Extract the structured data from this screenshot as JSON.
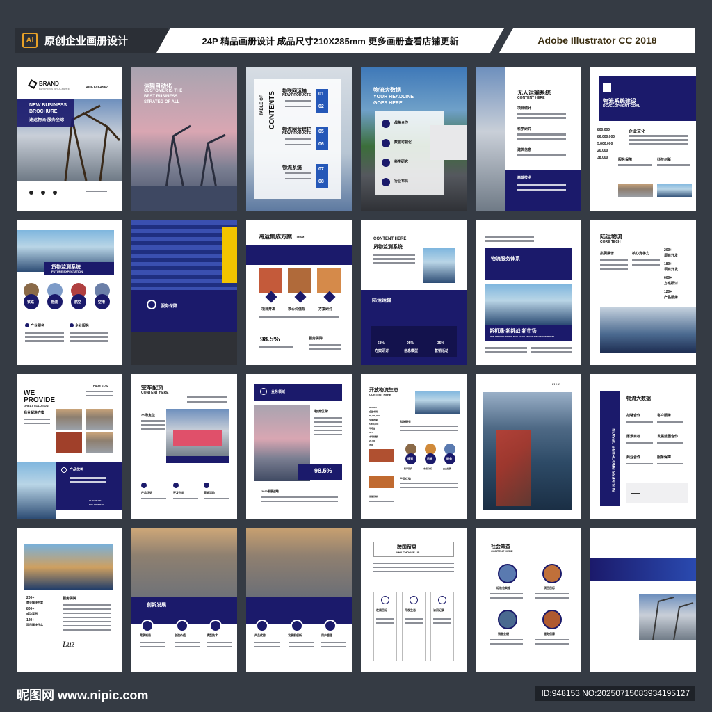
{
  "header": {
    "ai_badge": "Ai",
    "left_title": "原创企业画册设计",
    "center_title": "24P 精品画册设计 成品尺寸210X285mm 更多画册查看店铺更新",
    "right_title": "Adobe Illustrator CC 2018"
  },
  "pages": {
    "p1": {
      "brand": "BRAND",
      "brand_sub": "BUSINESS BROCHURE",
      "title1": "NEW BUSINESS",
      "title2": "BROCHURE",
      "cn": "速运物流·服务全球",
      "phone": "400-123-4567"
    },
    "p2": {
      "cn": "运输自动化",
      "en1": "CUSTOMER IS THE",
      "en2": "BEST BUSINESS",
      "en3": "STRATEG OF ALL"
    },
    "p3": {
      "toc_a": "TABLE OF",
      "toc_b": "CONTENTS",
      "s1": "物联网运输",
      "s1e": "NEW PRODUCTS",
      "s2": "物流网营建护",
      "s2e": "NEW PRODUCTS",
      "s3": "物流系统",
      "n1": "01",
      "n2": "02",
      "n3": "05",
      "n4": "06",
      "n5": "07",
      "n6": "08"
    },
    "p4": {
      "cn": "物流大数据",
      "en1": "YOUR HEADLINE",
      "en2": "GOES HERE",
      "i1": "战略合作",
      "i2": "数据可视化",
      "i3": "科学研究",
      "i4": "行业布局"
    },
    "p5": {
      "cn": "无人运输系统",
      "en": "CONTENT HERE",
      "a": "项目统计",
      "b": "科学研究",
      "c": "建筑信息",
      "d": "高端技术"
    },
    "p6": {
      "cn": "物流系统建设",
      "en": "DEVELOPMENT GOAL",
      "a": "企业文化",
      "b": "服务保障",
      "c": "科技创新",
      "n1": "800,000",
      "n2": "86,000,000",
      "n3": "5,800,000",
      "n4": "20,000",
      "n5": "38,000"
    },
    "p7": {
      "cn": "货物监测系统",
      "en": "FUTURE EXPECTATION",
      "c1": "铁路",
      "c2": "物流",
      "c3": "航空",
      "c4": "空港",
      "b1": "产业服务",
      "b2": "企业服务"
    },
    "p8": {
      "cn": "服务保障"
    },
    "p9": {
      "cn": "海运集成方案",
      "en": "TEAM",
      "a": "项目开发",
      "b": "核心价值观",
      "c": "方案研讨",
      "pct": "98.5%",
      "d": "服务保障"
    },
    "p10": {
      "en": "CONTENT HERE",
      "cn": "货物监测系统",
      "band": "陆运运输",
      "s1": "68%",
      "s1l": "方案研讨",
      "s2": "95%",
      "s2l": "信息模型",
      "s3": "35%",
      "s3l": "营销活动"
    },
    "p11": {
      "cn": "物流服务体系",
      "band": "新机遇·新挑战·新市场",
      "band_en": "NEW OPPORTUNITIES, NEW CHALLENGES AND NEW MARKETS"
    },
    "p12": {
      "cn": "陆运物流",
      "en": "CORE TECH",
      "a": "案例展示",
      "b": "核心竞争力",
      "n1": "200+",
      "l1": "项目开发",
      "n2": "180+",
      "l2": "项目开发",
      "n3": "600+",
      "l3": "方案研讨",
      "n4": "120+",
      "l4": "产品服务"
    },
    "p13": {
      "en1": "WE",
      "en2": "PROVIDE",
      "en3": "GREAT SOLUTION",
      "page": "PAGE 01/02",
      "a": "商业解决方案",
      "b": "产品优势",
      "c": "OUR VALUE",
      "d": "THE COMPANY"
    },
    "p14": {
      "cn": "空车配货",
      "en": "CONTENT HERE",
      "a": "市场定位",
      "b": "产品优势",
      "c": "开发生态",
      "d": "营销活动"
    },
    "p15": {
      "cn": "业务领域",
      "a": "物流优势",
      "pct": "98.5%",
      "b": "2030发展战略"
    },
    "p16": {
      "cn": "开放物流生态",
      "en": "CONTENT HERE",
      "n1": "800,000",
      "l1": "全国布局",
      "n2": "86,000,000",
      "l2": "全国布局",
      "n3": "5,800,000",
      "l3": "年收益",
      "n4": "30%",
      "l4": "市场份额",
      "n5": "20,000",
      "l5": "市场",
      "a": "科学研究",
      "c1": "规划",
      "c2": "目标",
      "c3": "服务",
      "d1": "科学研究",
      "d2": "市场分析",
      "d3": "企业优势",
      "e": "产品优势",
      "f": "发展目标"
    },
    "p17": {
      "page": "01 / 02"
    },
    "p18": {
      "side": "BUSINESS BROCHURE DESIGN",
      "cn": "物流大数据",
      "a": "战略合作",
      "b": "客户服务",
      "c": "愿景目标",
      "d": "发展蓝图合作",
      "e": "商业合作",
      "f": "服务保障"
    },
    "p19": {
      "n1": "200+",
      "l1": "商业解决方案",
      "n2": "800+",
      "l2": "成功案例",
      "n3": "120+",
      "l3": "项目解决什么",
      "a": "服务保障",
      "sig": "Luz"
    },
    "p20": {
      "band": "创新发展",
      "a": "竞争格局",
      "b": "创造价值",
      "c": "模型技术"
    },
    "p21": {
      "a": "产品优势",
      "b": "发展前创新",
      "c": "用户管理"
    },
    "p22": {
      "cn": "跨国贸易",
      "en": "WHY CHOOSE US",
      "a": "发展目标",
      "b": "开发生态",
      "c": "访问记录"
    },
    "p23": {
      "cn": "社会效益",
      "en": "CONTENT HERE",
      "a": "标准化实施",
      "b": "项目目标",
      "c": "销售业绩",
      "d": "服务保障"
    }
  },
  "footer": {
    "logo": "昵图网 www.nipic.com",
    "id": "ID:948153 NO:20250715083934195127"
  },
  "colors": {
    "navy": "#1b1a6b",
    "accent_blue": "#2558b8",
    "background": "#353b44",
    "ai_orange": "#e7a128"
  }
}
